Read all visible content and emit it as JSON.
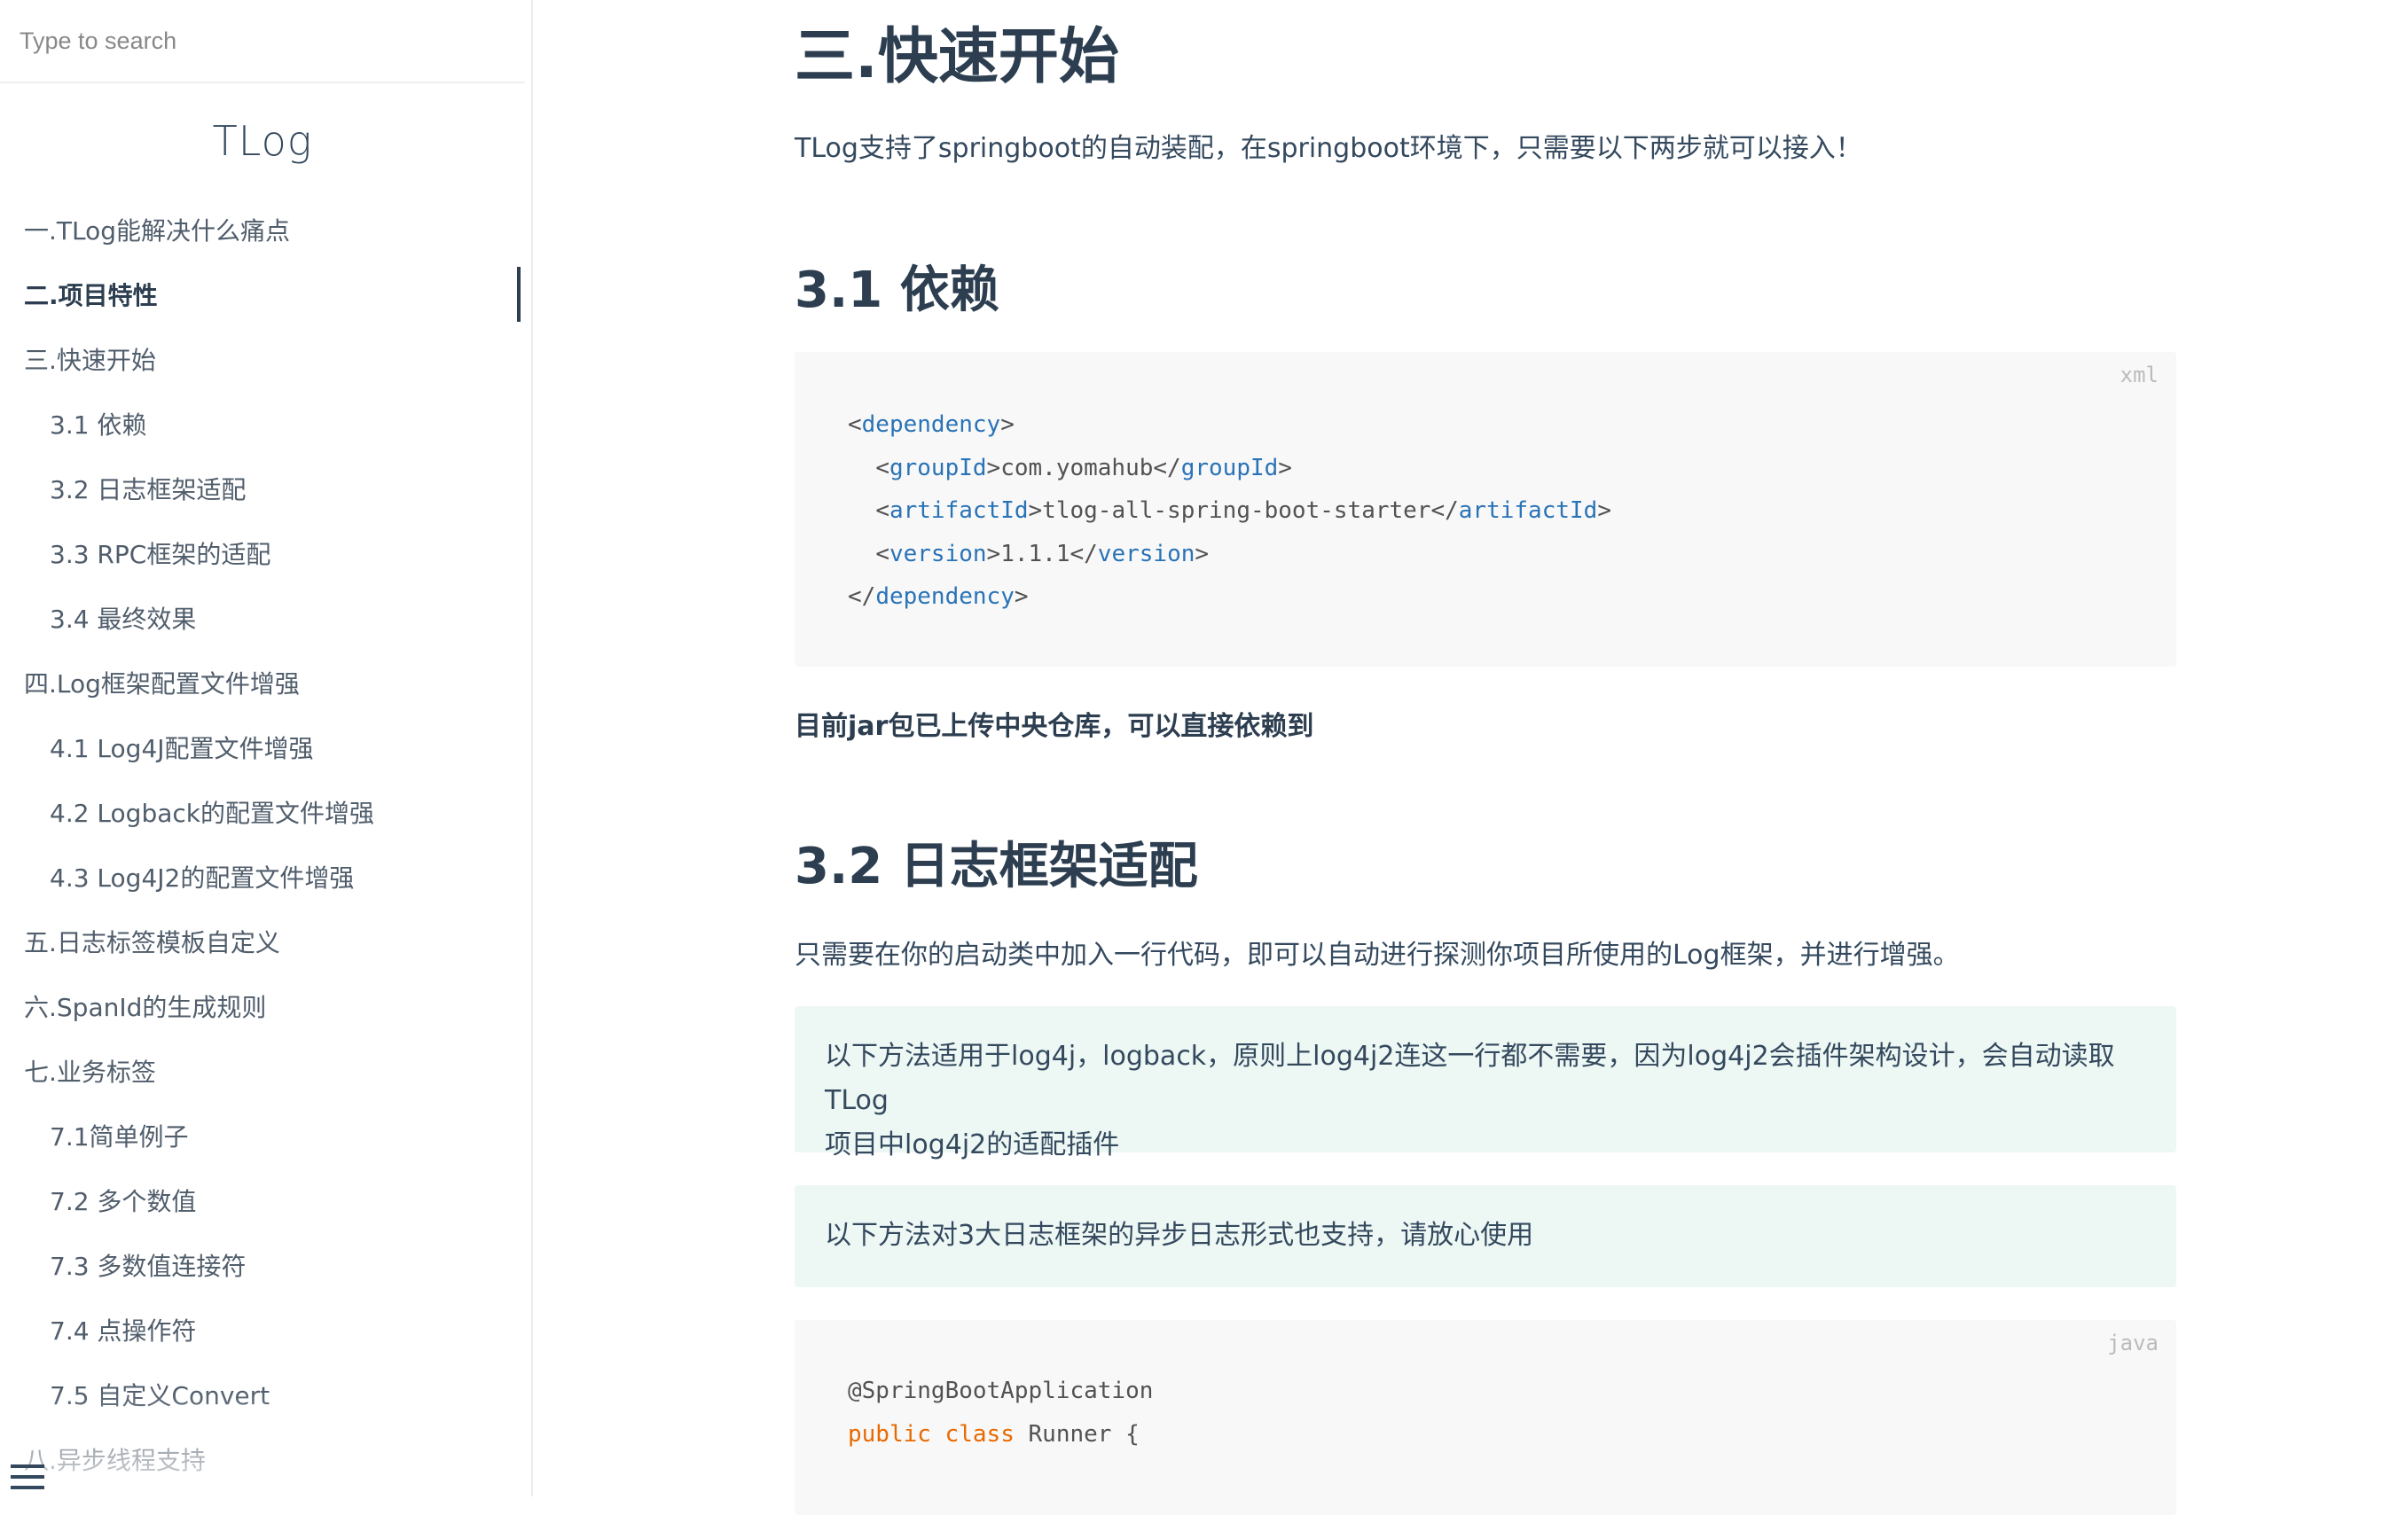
{
  "search": {
    "placeholder": "Type to search"
  },
  "app_name": "TLog",
  "toc": [
    {
      "label": "一.TLog能解决什么痛点",
      "level": 1
    },
    {
      "label": "二.项目特性",
      "level": 1,
      "active": true
    },
    {
      "label": "三.快速开始",
      "level": 1
    },
    {
      "label": "3.1 依赖",
      "level": 2
    },
    {
      "label": "3.2 日志框架适配",
      "level": 2
    },
    {
      "label": "3.3 RPC框架的适配",
      "level": 2
    },
    {
      "label": "3.4 最终效果",
      "level": 2
    },
    {
      "label": "四.Log框架配置文件增强",
      "level": 1
    },
    {
      "label": "4.1 Log4J配置文件增强",
      "level": 2
    },
    {
      "label": "4.2 Logback的配置文件增强",
      "level": 2
    },
    {
      "label": "4.3 Log4J2的配置文件增强",
      "level": 2
    },
    {
      "label": "五.日志标签模板自定义",
      "level": 1
    },
    {
      "label": "六.SpanId的生成规则",
      "level": 1
    },
    {
      "label": "七.业务标签",
      "level": 1
    },
    {
      "label": "7.1简单例子",
      "level": 2
    },
    {
      "label": "7.2 多个数值",
      "level": 2
    },
    {
      "label": "7.3 多数值连接符",
      "level": 2
    },
    {
      "label": "7.4 点操作符",
      "level": 2
    },
    {
      "label": "7.5 自定义Convert",
      "level": 2
    },
    {
      "label": "八.异步线程支持",
      "level": 1
    }
  ],
  "content": {
    "h_quickstart": "三.快速开始",
    "intro": "TLog支持了springboot的自动装配，在springboot环境下，只需要以下两步就可以接入！",
    "h_dependency": "3.1 依赖",
    "code_xml": {
      "lang": "xml",
      "lines": [
        {
          "indent": 0,
          "open": "dependency",
          "text": "",
          "close": ""
        },
        {
          "indent": 1,
          "open": "groupId",
          "text": "com.yomahub",
          "close": "groupId"
        },
        {
          "indent": 1,
          "open": "artifactId",
          "text": "tlog-all-spring-boot-starter",
          "close": "artifactId"
        },
        {
          "indent": 1,
          "open": "version",
          "text": "1.1.1",
          "close": "version"
        },
        {
          "indent": 0,
          "open": "",
          "text": "",
          "close": "dependency"
        }
      ]
    },
    "note": "目前jar包已上传中央仓库，可以直接依赖到",
    "h_log_adapt": "3.2 日志框架适配",
    "adapt_desc": "只需要在你的启动类中加入一行代码，即可以自动进行探测你项目所使用的Log框架，并进行增强。",
    "tip1_line1": "以下方法适用于log4j，logback，原则上log4j2连这一行都不需要，因为log4j2会插件架构设计，会自动读取TLog",
    "tip1_line2": "项目中log4j2的适配插件",
    "tip2": "以下方法对3大日志框架的异步日志形式也支持，请放心使用",
    "code_java": {
      "lang": "java",
      "annotation": "@SpringBootApplication",
      "kw_public": "public",
      "kw_class": "class",
      "class_decl": "Runner {"
    }
  }
}
